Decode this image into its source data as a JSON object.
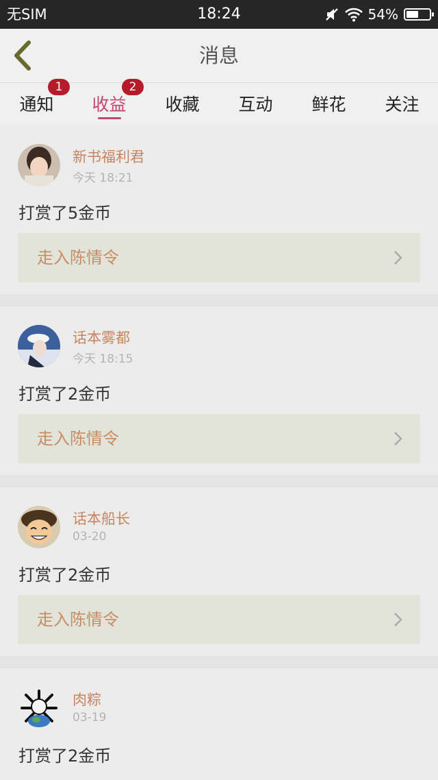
{
  "status_bar": {
    "carrier": "无SIM",
    "time": "18:24",
    "battery_percent": "54%",
    "battery_level": 0.54
  },
  "header": {
    "title": "消息",
    "back_icon": "chevron-left-icon"
  },
  "tabs": [
    {
      "label": "通知",
      "badge": "1",
      "active": false
    },
    {
      "label": "收益",
      "badge": "2",
      "active": true
    },
    {
      "label": "收藏",
      "badge": "",
      "active": false
    },
    {
      "label": "互动",
      "badge": "",
      "active": false
    },
    {
      "label": "鲜花",
      "badge": "",
      "active": false
    },
    {
      "label": "关注",
      "badge": "",
      "active": false
    }
  ],
  "messages": [
    {
      "user": "新书福利君",
      "time": "今天 18:21",
      "text": "打赏了5金币",
      "book": "走入陈情令"
    },
    {
      "user": "话本雾都",
      "time": "今天 18:15",
      "text": "打赏了2金币",
      "book": "走入陈情令"
    },
    {
      "user": "话本船长",
      "time": "03-20",
      "text": "打赏了2金币",
      "book": "走入陈情令"
    },
    {
      "user": "肉粽",
      "time": "03-19",
      "text": "打赏了2金币",
      "book": ""
    }
  ],
  "colors": {
    "accent": "#c2466e",
    "badge": "#b51c2a",
    "username": "#c7845e",
    "book_title": "#c88c63"
  }
}
